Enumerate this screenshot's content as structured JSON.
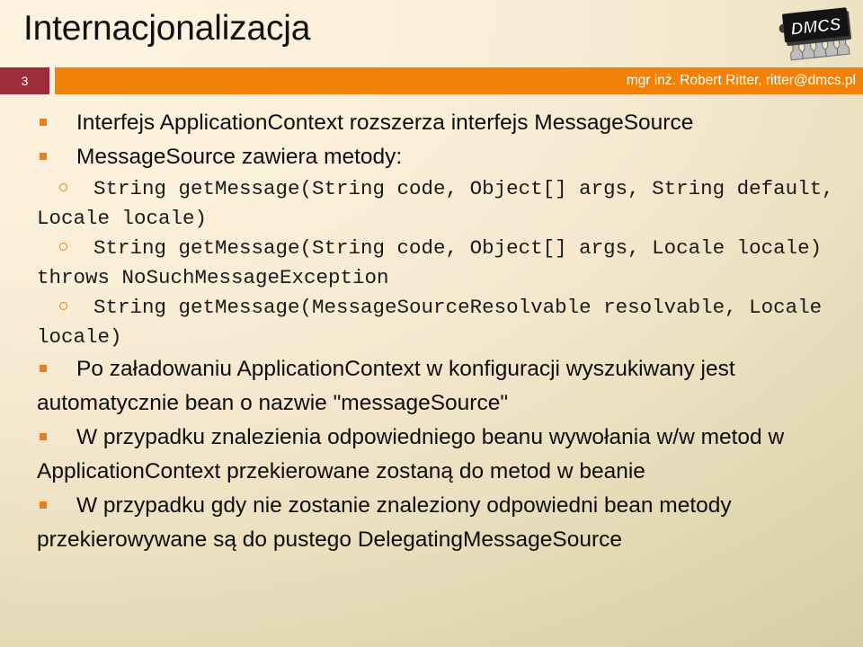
{
  "header": {
    "title": "Internacjonalizacja",
    "page_number": "3",
    "author": "mgr inż. Robert Ritter, ritter@dmcs.pl",
    "logo_text": "DMCS",
    "logo_icon": "dip-chip-icon"
  },
  "colors": {
    "bar_orange": "#F08208",
    "badge_maroon": "#9E2D3C",
    "bullet_orange": "#E8801A",
    "background_light": "#FBEFD9",
    "background_dark": "#D6CCA4",
    "text": "#0D0D0D",
    "footer_text": "#FFFFFF"
  },
  "content": {
    "blocks": [
      {
        "level": 1,
        "marker": "square-bullet",
        "text": "Interfejs ApplicationContext rozszerza interfejs MessageSource"
      },
      {
        "level": 1,
        "marker": "square-bullet",
        "text": "MessageSource zawiera metody:"
      },
      {
        "level": 2,
        "marker": "circle-bullet",
        "text": "String getMessage(String code, Object[] args, String default, Locale locale)"
      },
      {
        "level": 2,
        "marker": "circle-bullet",
        "text": "String getMessage(String code, Object[] args, Locale locale) throws NoSuchMessageException"
      },
      {
        "level": 2,
        "marker": "circle-bullet",
        "text": "String getMessage(MessageSourceResolvable resolvable, Locale locale)"
      },
      {
        "level": 1,
        "marker": "square-bullet",
        "text": "Po załadowaniu ApplicationContext w konfiguracji wyszukiwany jest automatycznie bean o nazwie \"messageSource\""
      },
      {
        "level": 1,
        "marker": "square-bullet",
        "text": "W przypadku znalezienia odpowiedniego beanu wywołania w/w metod w ApplicationContext przekierowane zostaną do metod w beanie"
      },
      {
        "level": 1,
        "marker": "square-bullet",
        "text": "W przypadku gdy nie zostanie znaleziony odpowiedni bean metody przekierowywane są do pustego DelegatingMessageSource"
      }
    ]
  }
}
